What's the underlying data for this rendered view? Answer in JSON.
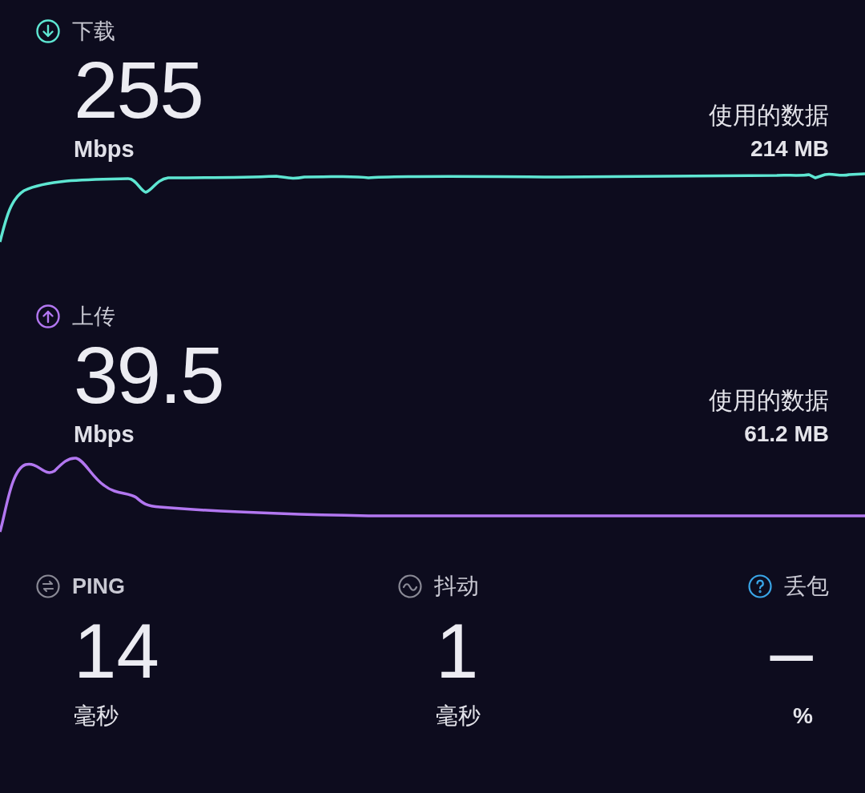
{
  "tests": [
    {
      "kind": "download",
      "label": "下载",
      "value": "255",
      "unit": "Mbps",
      "data_label": "使用的数据",
      "data_value": "214 MB",
      "color": "#5ee6d2"
    },
    {
      "kind": "upload",
      "label": "上传",
      "value": "39.5",
      "unit": "Mbps",
      "data_label": "使用的数据",
      "data_value": "61.2 MB",
      "color": "#b277f0"
    }
  ],
  "metrics": [
    {
      "kind": "ping",
      "label": "PING",
      "value": "14",
      "unit": "毫秒"
    },
    {
      "kind": "jitter",
      "label": "抖动",
      "value": "1",
      "unit": "毫秒"
    },
    {
      "kind": "loss",
      "label": "丢包",
      "value": "–",
      "unit": "%"
    }
  ]
}
